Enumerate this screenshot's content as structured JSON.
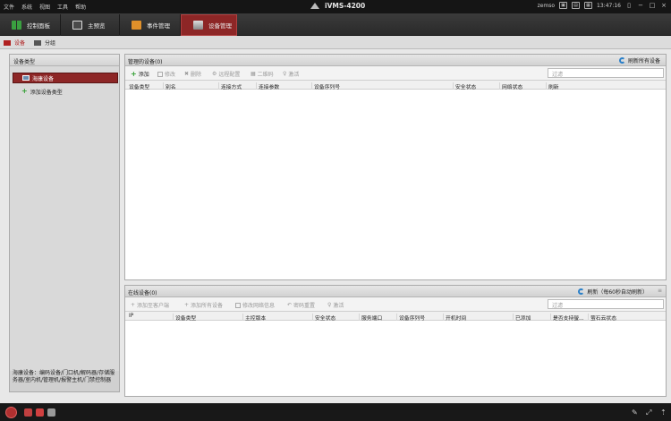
{
  "titlebar": {
    "menu": [
      "文件",
      "系统",
      "视图",
      "工具",
      "帮助"
    ],
    "app_title": "iVMS-4200",
    "user": "zemso",
    "time": "13:47:16"
  },
  "nav": {
    "tabs": [
      {
        "label": "控制面板"
      },
      {
        "label": "主预览"
      },
      {
        "label": "事件管理"
      },
      {
        "label": "设备管理"
      }
    ]
  },
  "subtabs": [
    "设备",
    "分组"
  ],
  "left_panel": {
    "header": "设备类型",
    "items": [
      "海康设备",
      "添加设备类型"
    ],
    "note": "海康设备：编码设备/门口机/解码器/存储服务器/室内机/管理机/报警主机/门禁控制器"
  },
  "managed_panel": {
    "title": "管理的设备(0)",
    "refresh_all": "刷新所有设备",
    "toolbar": [
      "添加",
      "修改",
      "删除",
      "远程配置",
      "二维码",
      "激活"
    ],
    "filter_placeholder": "过滤",
    "columns": [
      "设备类型",
      "别名",
      "连接方式",
      "连接参数",
      "设备序列号",
      "安全状态",
      "网络状态",
      "刷新"
    ]
  },
  "online_panel": {
    "title": "在线设备(0)",
    "refresh": "刷新（每60秒自动刷新）",
    "toolbar": [
      "添加至客户端",
      "添加所有设备",
      "修改网络信息",
      "密码重置",
      "激活"
    ],
    "filter_placeholder": "过滤",
    "columns": [
      "IP",
      "设备类型",
      "主控版本",
      "安全状态",
      "服务端口",
      "设备序列号",
      "开机时间",
      "已添加",
      "是否支持螢...",
      "萤石云状态"
    ]
  },
  "colors": {
    "accent": "#8d2626",
    "titlebar_bg": "#151515",
    "panel_header": "#d8d8d8"
  }
}
